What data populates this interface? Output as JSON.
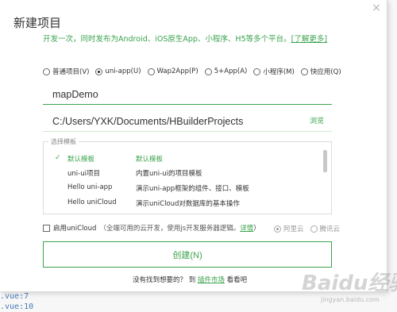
{
  "dialog": {
    "title": "新建项目",
    "close_glyph": "×",
    "subtitle": "开发一次，同时发布为Android、iOS原生App、小程序、H5等多个平台。",
    "learn_more": "[了解更多]"
  },
  "project_types": [
    {
      "label": "普通项目(V)",
      "selected": false
    },
    {
      "label": "uni-app(U)",
      "selected": true
    },
    {
      "label": "Wap2App(P)",
      "selected": false
    },
    {
      "label": "5+App(A)",
      "selected": false
    },
    {
      "label": "小程序(M)",
      "selected": false
    },
    {
      "label": "快应用(Q)",
      "selected": false
    }
  ],
  "project_name": {
    "value": "mapDemo"
  },
  "project_path": {
    "value": "C:/Users/YXK/Documents/HBuilderProjects",
    "browse_label": "浏览"
  },
  "templates": {
    "legend": "选择模板",
    "check_glyph": "✓",
    "items": [
      {
        "name": "默认模板",
        "desc": "默认模板",
        "selected": true
      },
      {
        "name": "uni-ui项目",
        "desc": "内置uni-ui的项目模板",
        "selected": false
      },
      {
        "name": "Hello uni-app",
        "desc": "演示uni-app框架的组件、接口、模板",
        "selected": false
      },
      {
        "name": "Hello uniCloud",
        "desc": "演示uniCloud对数据库的基本操作",
        "selected": false
      }
    ]
  },
  "unicloud": {
    "label": "启用uniCloud",
    "hint": "（全端可用的云开发，使用js开发服务器逻辑。",
    "details": "详情",
    "hint_end": "）",
    "providers": [
      {
        "label": "阿里云",
        "selected": true
      },
      {
        "label": "腾讯云",
        "selected": false
      }
    ]
  },
  "create_button": "创建(N)",
  "footer": {
    "prefix": "没有找到想要的？ 到",
    "link": "插件市场",
    "suffix": "看看吧"
  },
  "background_code": [
    "  .vue:7",
    ".vue:10"
  ],
  "watermark": {
    "main": "Baidu经验",
    "sub": "jingyan.baidu.com"
  },
  "colors": {
    "accent": "#3ba34d"
  }
}
